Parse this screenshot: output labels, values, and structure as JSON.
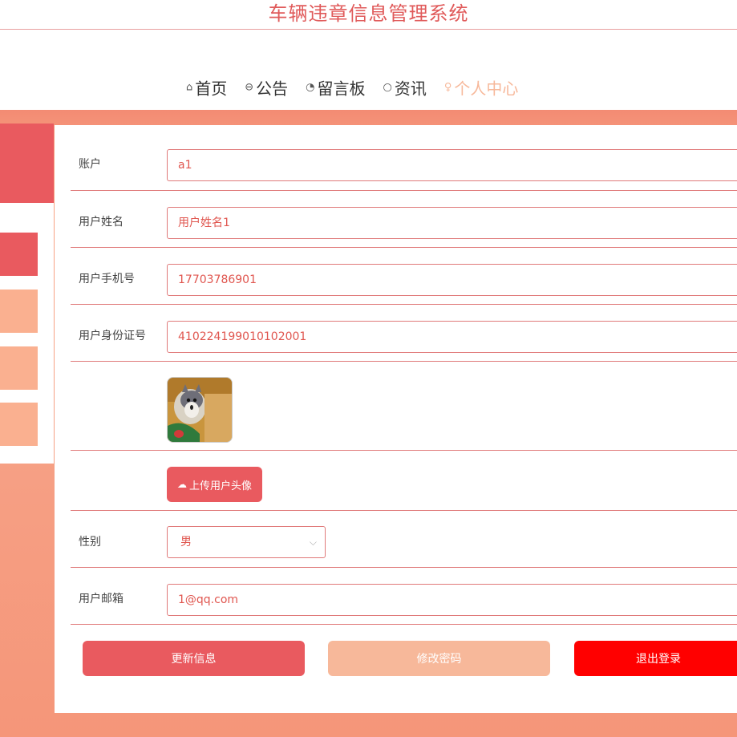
{
  "header": {
    "title": "车辆违章信息管理系统"
  },
  "nav": {
    "items": [
      {
        "icon": "⌂",
        "label": "首页"
      },
      {
        "icon": "⊖",
        "label": "公告"
      },
      {
        "icon": "◔",
        "label": "留言板"
      },
      {
        "icon": "○",
        "label": "资讯"
      },
      {
        "icon": "♀",
        "label": "个人中心"
      }
    ],
    "active_index": 4
  },
  "form": {
    "account": {
      "label": "账户",
      "value": "a1"
    },
    "name": {
      "label": "用户姓名",
      "value": "用户姓名1"
    },
    "phone": {
      "label": "用户手机号",
      "value": "17703786901"
    },
    "idcard": {
      "label": "用户身份证号",
      "value": "410224199010102001"
    },
    "upload_label": "上传用户头像",
    "gender": {
      "label": "性别",
      "value": "男"
    },
    "email": {
      "label": "用户邮箱",
      "value": "1@qq.com"
    }
  },
  "actions": {
    "update": "更新信息",
    "change_password": "修改密码",
    "logout": "退出登录"
  },
  "colors": {
    "primary": "#e95a5f",
    "accent": "#f7b89a",
    "danger": "#ff0000",
    "band": "#f6a186"
  }
}
